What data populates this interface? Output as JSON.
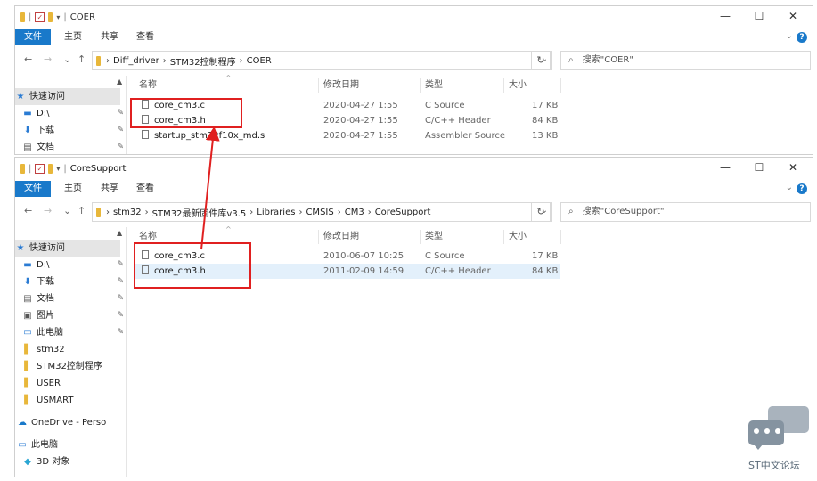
{
  "ribbon": {
    "file": "文件",
    "home": "主页",
    "share": "共享",
    "view": "查看"
  },
  "window_controls": {
    "minimize": "—",
    "maximize": "☐",
    "close": "✕"
  },
  "nav_buttons": {
    "back": "←",
    "forward": "→",
    "recent": "⌄",
    "up": "↑"
  },
  "top_window": {
    "title": "COER",
    "address": [
      "Diff_driver",
      "STM32控制程序",
      "COER"
    ],
    "search_placeholder": "搜索\"COER\"",
    "sidebar": [
      {
        "label": "快速访问",
        "icon": "star-icon"
      },
      {
        "label": "D:\\",
        "icon": "drive-icon"
      },
      {
        "label": "下载",
        "icon": "download-icon"
      },
      {
        "label": "文档",
        "icon": "document-icon"
      }
    ],
    "columns": {
      "name": "名称",
      "date": "修改日期",
      "type": "类型",
      "size": "大小"
    },
    "files": [
      {
        "name": "core_cm3.c",
        "date": "2020-04-27 1:55",
        "type": "C Source",
        "size": "17 KB"
      },
      {
        "name": "core_cm3.h",
        "date": "2020-04-27 1:55",
        "type": "C/C++ Header",
        "size": "84 KB"
      },
      {
        "name": "startup_stm32f10x_md.s",
        "date": "2020-04-27 1:55",
        "type": "Assembler Source",
        "size": "13 KB"
      }
    ]
  },
  "bottom_window": {
    "title": "CoreSupport",
    "address": [
      "stm32",
      "STM32最新固件库v3.5",
      "Libraries",
      "CMSIS",
      "CM3",
      "CoreSupport"
    ],
    "search_placeholder": "搜索\"CoreSupport\"",
    "sidebar": [
      {
        "label": "快速访问",
        "icon": "star-icon"
      },
      {
        "label": "D:\\",
        "icon": "drive-icon"
      },
      {
        "label": "下载",
        "icon": "download-icon"
      },
      {
        "label": "文档",
        "icon": "document-icon"
      },
      {
        "label": "图片",
        "icon": "picture-icon"
      },
      {
        "label": "此电脑",
        "icon": "computer-icon"
      },
      {
        "label": "stm32",
        "icon": "folder-icon"
      },
      {
        "label": "STM32控制程序",
        "icon": "folder-icon"
      },
      {
        "label": "USER",
        "icon": "folder-icon"
      },
      {
        "label": "USMART",
        "icon": "folder-icon"
      },
      {
        "label": "OneDrive - Perso",
        "icon": "cloud-icon"
      },
      {
        "label": "此电脑",
        "icon": "computer-icon"
      },
      {
        "label": "3D 对象",
        "icon": "cube-icon"
      }
    ],
    "columns": {
      "name": "名称",
      "date": "修改日期",
      "type": "类型",
      "size": "大小"
    },
    "files": [
      {
        "name": "core_cm3.c",
        "date": "2010-06-07 10:25",
        "type": "C Source",
        "size": "17 KB"
      },
      {
        "name": "core_cm3.h",
        "date": "2011-02-09 14:59",
        "type": "C/C++ Header",
        "size": "84 KB"
      }
    ]
  },
  "watermark": "ST中文论坛",
  "colors": {
    "accent": "#1979ca",
    "highlight": "#e02020",
    "selected_row": "#e3f0fb"
  }
}
